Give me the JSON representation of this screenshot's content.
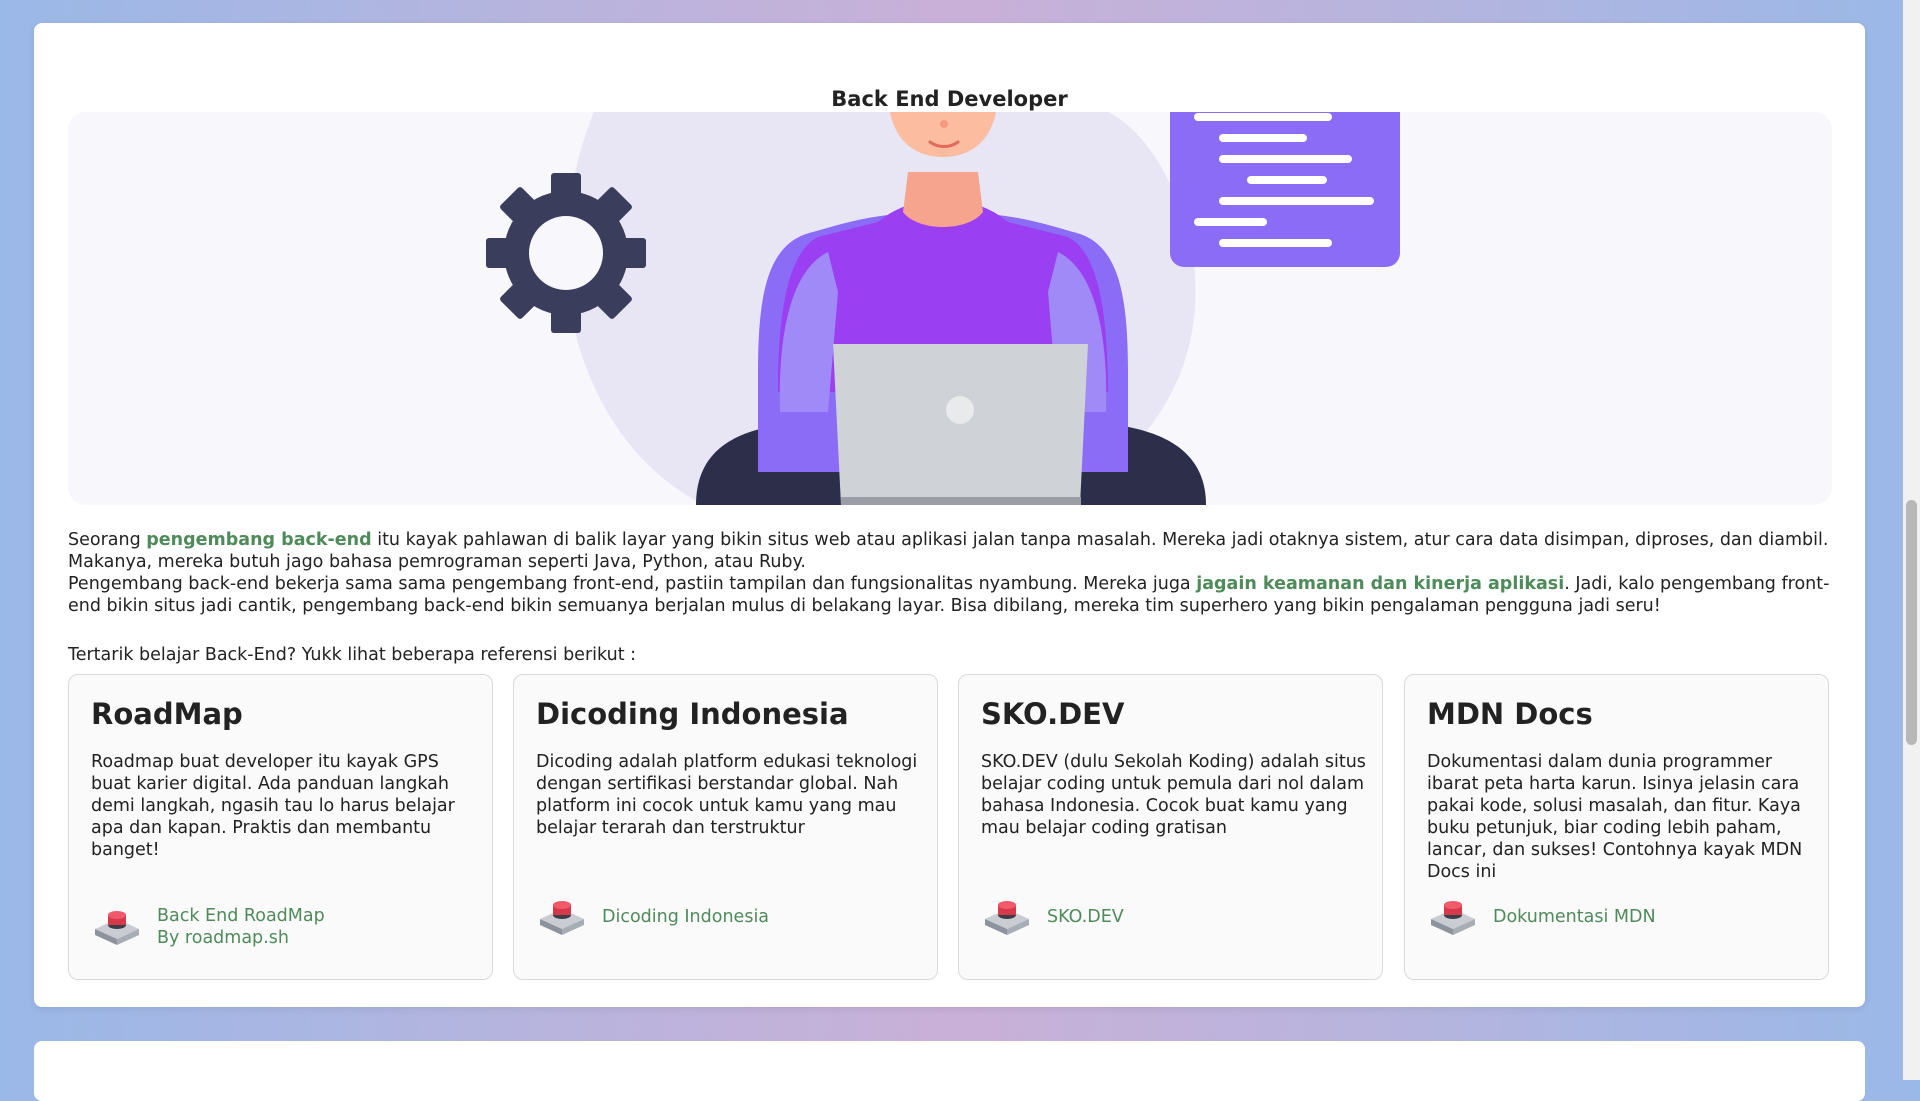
{
  "section": {
    "title": "Back End Developer",
    "description": {
      "p1_before": "Seorang ",
      "p1_highlight": "pengembang back-end",
      "p1_after": " itu kayak pahlawan di balik layar yang bikin situs web atau aplikasi jalan tanpa masalah. Mereka jadi otaknya sistem, atur cara data disimpan, diproses, dan diambil. Makanya, mereka butuh jago bahasa pemrograman seperti Java, Python, atau Ruby.",
      "p2_before": "Pengembang back-end bekerja sama sama pengembang front-end, pastiin tampilan dan fungsionalitas nyambung. Mereka juga ",
      "p2_highlight": "jagain keamanan dan kinerja aplikasi",
      "p2_after": ". Jadi, kalo pengembang front-end bikin situs jadi cantik, pengembang back-end bikin semuanya berjalan mulus di belakang layar. Bisa dibilang, mereka tim superhero yang bikin pengalaman pengguna jadi seru!"
    },
    "cta": "Tertarik belajar Back-End? Yukk lihat beberapa referensi berikut :"
  },
  "cards": [
    {
      "title": "RoadMap",
      "text": "Roadmap buat developer itu kayak GPS buat karier digital. Ada panduan langkah demi langkah, ngasih tau lo harus belajar apa dan kapan. Praktis dan membantu banget!",
      "link_line1": "Back End RoadMap",
      "link_line2": "By roadmap.sh"
    },
    {
      "title": "Dicoding Indonesia",
      "text": "Dicoding adalah platform edukasi teknologi dengan sertifikasi berstandar global. Nah platform ini cocok untuk kamu yang mau belajar terarah dan terstruktur",
      "link_line1": "Dicoding Indonesia",
      "link_line2": ""
    },
    {
      "title": "SKO.DEV",
      "text": "SKO.DEV (dulu Sekolah Koding) adalah situs belajar coding untuk pemula dari nol dalam bahasa Indonesia. Cocok buat kamu yang mau belajar coding gratisan",
      "link_line1": "SKO.DEV",
      "link_line2": ""
    },
    {
      "title": "MDN Docs",
      "text": "Dokumentasi dalam dunia programmer ibarat peta harta karun. Isinya jelasin cara pakai kode, solusi masalah, dan fitur. Kaya buku petunjuk, biar coding lebih paham, lancar, dan sukses! Contohnya kayak MDN Docs ini",
      "link_line1": "Dokumentasi MDN",
      "link_line2": ""
    }
  ],
  "icons": {
    "hero": "developer-illustration",
    "link": "push-button-icon"
  },
  "colors": {
    "accent_green": "#4f8a5b",
    "purple": "#7b61ff"
  }
}
